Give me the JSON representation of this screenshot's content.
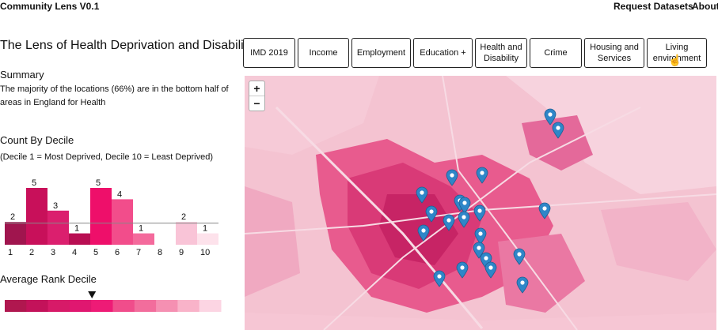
{
  "app": {
    "title": "Community Lens V0.1"
  },
  "nav": {
    "request_label": "Request Datasets",
    "about_label": "About"
  },
  "page": {
    "title": "The Lens of Health Deprivation and Disability"
  },
  "summary": {
    "heading": "Summary",
    "line1": "The majority of the locations (66%) are in the bottom half of",
    "line2": "areas in England for Health"
  },
  "count": {
    "heading": "Count By Decile",
    "note": "(Decile 1 = Most Deprived, Decile 10 = Least Deprived)"
  },
  "chart_data": {
    "type": "bar",
    "categories": [
      "1",
      "2",
      "3",
      "4",
      "5",
      "6",
      "7",
      "8",
      "9",
      "10"
    ],
    "values": [
      2,
      5,
      3,
      1,
      5,
      4,
      1,
      0,
      2,
      1
    ],
    "colors": [
      "#a0154e",
      "#c8105a",
      "#db1f6e",
      "#b80e52",
      "#ee0f6a",
      "#f24d8b",
      "#f46a9c",
      "#f8a8c3",
      "#f9c4d7",
      "#fde2eb"
    ],
    "reference_line": 1.9,
    "ylim": [
      0,
      5
    ]
  },
  "average": {
    "heading": "Average Rank Decile",
    "colors": [
      "#b0174f",
      "#c3125a",
      "#d71a68",
      "#e01770",
      "#ee1b76",
      "#f04d8b",
      "#f26d9c",
      "#f590b2",
      "#f9b3c9",
      "#fcd5e3"
    ],
    "marker_decile": 4.5
  },
  "tabs": [
    {
      "label": "IMD 2019",
      "active": false
    },
    {
      "label": "Income",
      "active": false
    },
    {
      "label": "Employment",
      "active": false
    },
    {
      "label": "Education +",
      "active": false
    },
    {
      "label": "Health and Disability",
      "active": true
    },
    {
      "label": "Crime",
      "active": false
    },
    {
      "label": "Housing and Services",
      "active": false
    },
    {
      "label": "Living environment",
      "active": false
    }
  ],
  "map": {
    "zoom_in_label": "+",
    "zoom_out_label": "−",
    "marker_color": "#2f86c8",
    "marker_icon": "map-pin-icon",
    "zoom_icons": [
      "plus-icon",
      "minus-icon"
    ]
  }
}
